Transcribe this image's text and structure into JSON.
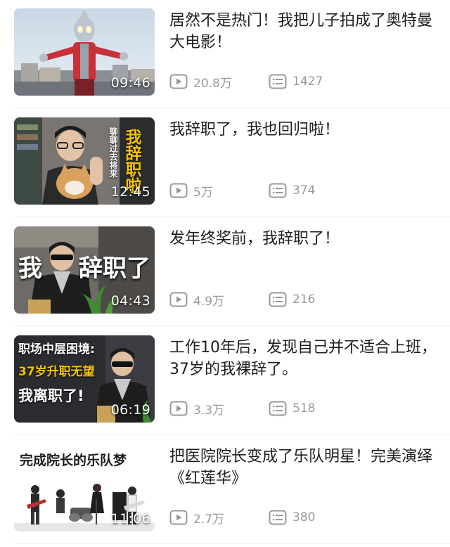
{
  "videos": [
    {
      "title": "居然不是热门！我把儿子拍成了奥特曼大电影！",
      "duration": "09:46",
      "views": "20.8万",
      "comments": "1427",
      "thumb_text": []
    },
    {
      "title": "我辞职了，我也回归啦！",
      "duration": "12:45",
      "views": "5万",
      "comments": "374",
      "thumb_text": [
        "我辞职啦",
        "聊聊过去将来"
      ]
    },
    {
      "title": "发年终奖前，我辞职了！",
      "duration": "04:43",
      "views": "4.9万",
      "comments": "216",
      "thumb_text": [
        "我",
        "辞职了"
      ]
    },
    {
      "title": "工作10年后，发现自己并不适合上班，37岁的我裸辞了。",
      "duration": "06:19",
      "views": "3.3万",
      "comments": "518",
      "thumb_text": [
        "职场中层困境:",
        "37岁升职无望",
        "我离职了!"
      ]
    },
    {
      "title": "把医院院长变成了乐队明星！完美演绎《红莲华》",
      "duration": "11:06",
      "views": "2.7万",
      "comments": "380",
      "thumb_text": [
        "完成院长的乐队梦"
      ]
    }
  ],
  "icons": {
    "views": "play-count-icon",
    "comments": "comment-count-icon"
  },
  "colors": {
    "title": "#1e1e1e",
    "stat": "#999999",
    "divider": "#ececec",
    "accent_yellow": "#f5c400"
  }
}
